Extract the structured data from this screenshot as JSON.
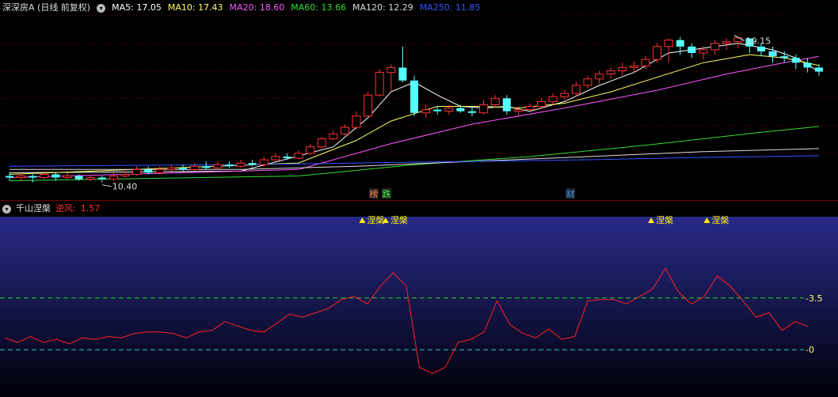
{
  "header": {
    "title": "深深房A (日线 前复权)",
    "ma_items": [
      {
        "label": "MA5:",
        "value": "17.05",
        "color": "#ffffff"
      },
      {
        "label": "MA10:",
        "value": "17.43",
        "color": "#ffff66"
      },
      {
        "label": "MA20:",
        "value": "18.60",
        "color": "#ff55ff"
      },
      {
        "label": "MA60:",
        "value": "13.66",
        "color": "#33dd33"
      },
      {
        "label": "MA120:",
        "value": "12.29",
        "color": "#dddddd"
      },
      {
        "label": "MA250:",
        "value": "11.85",
        "color": "#3355ff"
      }
    ]
  },
  "indicator": {
    "name": "千山涅槃",
    "wind_label": "逆风:",
    "wind_value": "1.57"
  },
  "colors": {
    "up": "#ff3333",
    "down": "#54ffff",
    "grid": "#7a0000",
    "ind_line": "#ff2222",
    "bg_top": "#272a88",
    "bg_bottom": "#000008"
  },
  "chart_data": [
    {
      "type": "candlestick",
      "name": "price",
      "ylim": [
        9.5,
        20.5
      ],
      "high_label": "19.15",
      "low_label": "10.40",
      "candles": [
        [
          10.6,
          10.5,
          10.8,
          10.3
        ],
        [
          10.5,
          10.6,
          10.8,
          10.3
        ],
        [
          10.6,
          10.5,
          10.7,
          10.2
        ],
        [
          10.5,
          10.7,
          10.9,
          10.4
        ],
        [
          10.7,
          10.5,
          10.8,
          10.3
        ],
        [
          10.5,
          10.6,
          10.8,
          10.4
        ],
        [
          10.6,
          10.4,
          10.7,
          10.3
        ],
        [
          10.4,
          10.5,
          10.6,
          10.3
        ],
        [
          10.5,
          10.4,
          10.6,
          10.2
        ],
        [
          10.4,
          10.6,
          10.8,
          10.3
        ],
        [
          10.6,
          10.7,
          10.9,
          10.5
        ],
        [
          10.7,
          11.0,
          11.2,
          10.6
        ],
        [
          11.0,
          10.8,
          11.2,
          10.7
        ],
        [
          10.8,
          11.0,
          11.2,
          10.7
        ],
        [
          11.0,
          11.1,
          11.3,
          10.9
        ],
        [
          11.1,
          11.0,
          11.3,
          10.9
        ],
        [
          11.0,
          11.2,
          11.4,
          10.9
        ],
        [
          11.2,
          11.1,
          11.5,
          11.0
        ],
        [
          11.1,
          11.3,
          11.5,
          11.0
        ],
        [
          11.3,
          11.2,
          11.5,
          11.1
        ],
        [
          11.2,
          11.4,
          11.6,
          11.1
        ],
        [
          11.4,
          11.3,
          11.6,
          11.2
        ],
        [
          11.3,
          11.6,
          11.8,
          11.2
        ],
        [
          11.6,
          11.8,
          12.0,
          11.5
        ],
        [
          11.8,
          11.7,
          12.0,
          11.6
        ],
        [
          11.7,
          12.0,
          12.2,
          11.6
        ],
        [
          12.0,
          12.4,
          12.6,
          11.9
        ],
        [
          12.4,
          12.9,
          13.0,
          12.3
        ],
        [
          12.9,
          13.2,
          13.4,
          12.8
        ],
        [
          13.2,
          13.6,
          13.8,
          13.1
        ],
        [
          13.6,
          14.3,
          14.6,
          13.5
        ],
        [
          14.3,
          15.6,
          15.8,
          14.2
        ],
        [
          15.6,
          17.0,
          17.2,
          15.5
        ],
        [
          17.0,
          17.3,
          17.5,
          15.8
        ],
        [
          17.3,
          16.5,
          18.6,
          16.4
        ],
        [
          16.5,
          14.5,
          16.8,
          14.3
        ],
        [
          14.5,
          14.7,
          15.0,
          14.2
        ],
        [
          14.7,
          14.6,
          14.9,
          14.4
        ],
        [
          14.6,
          14.8,
          15.0,
          14.4
        ],
        [
          14.8,
          14.6,
          15.0,
          14.5
        ],
        [
          14.6,
          14.5,
          14.9,
          14.3
        ],
        [
          14.5,
          15.0,
          15.3,
          14.4
        ],
        [
          15.0,
          15.4,
          15.6,
          14.8
        ],
        [
          15.4,
          14.6,
          15.6,
          14.4
        ],
        [
          14.6,
          14.7,
          14.9,
          14.3
        ],
        [
          14.7,
          14.9,
          15.1,
          14.6
        ],
        [
          14.9,
          15.2,
          15.4,
          14.8
        ],
        [
          15.2,
          15.5,
          15.7,
          15.0
        ],
        [
          15.5,
          15.7,
          15.9,
          15.3
        ],
        [
          15.7,
          16.2,
          16.4,
          15.5
        ],
        [
          16.2,
          16.6,
          16.8,
          16.0
        ],
        [
          16.6,
          16.9,
          17.1,
          16.3
        ],
        [
          16.9,
          17.1,
          17.3,
          16.6
        ],
        [
          17.1,
          17.3,
          17.6,
          16.8
        ],
        [
          17.3,
          17.4,
          17.7,
          17.0
        ],
        [
          17.4,
          17.8,
          18.0,
          17.2
        ],
        [
          17.8,
          18.6,
          18.8,
          17.6
        ],
        [
          18.6,
          19.0,
          19.1,
          17.6
        ],
        [
          19.0,
          18.6,
          19.2,
          18.1
        ],
        [
          18.6,
          18.2,
          18.8,
          17.9
        ],
        [
          18.2,
          18.4,
          18.6,
          17.8
        ],
        [
          18.4,
          18.8,
          19.0,
          18.1
        ],
        [
          18.8,
          18.9,
          19.1,
          18.4
        ],
        [
          18.9,
          19.15,
          19.15,
          18.5
        ],
        [
          19.1,
          18.6,
          19.1,
          18.2
        ],
        [
          18.6,
          18.3,
          18.8,
          18.0
        ],
        [
          18.3,
          18.0,
          18.6,
          17.6
        ],
        [
          18.0,
          17.9,
          18.3,
          17.6
        ],
        [
          17.9,
          17.6,
          18.1,
          17.2
        ],
        [
          17.6,
          17.3,
          17.9,
          17.0
        ],
        [
          17.3,
          17.05,
          17.5,
          16.8
        ]
      ],
      "ma_series": [
        {
          "name": "MA5",
          "color": "#ffffff",
          "points": [
            [
              0,
              10.8
            ],
            [
              20,
              10.9
            ],
            [
              28,
              12.4
            ],
            [
              31,
              14.2
            ],
            [
              33,
              15.8
            ],
            [
              35,
              16.4
            ],
            [
              37,
              15.6
            ],
            [
              39,
              14.9
            ],
            [
              41,
              14.8
            ],
            [
              43,
              14.9
            ],
            [
              45,
              14.6
            ],
            [
              48,
              15.2
            ],
            [
              51,
              16.2
            ],
            [
              54,
              17.0
            ],
            [
              57,
              18.2
            ],
            [
              60,
              18.5
            ],
            [
              63,
              18.8
            ],
            [
              66,
              18.4
            ],
            [
              68,
              17.9
            ],
            [
              70,
              17.05
            ]
          ]
        },
        {
          "name": "MA10",
          "color": "#ffff66",
          "points": [
            [
              0,
              10.7
            ],
            [
              25,
              11.4
            ],
            [
              30,
              12.8
            ],
            [
              33,
              14.0
            ],
            [
              37,
              14.9
            ],
            [
              41,
              14.9
            ],
            [
              44,
              14.8
            ],
            [
              48,
              15.1
            ],
            [
              52,
              15.8
            ],
            [
              56,
              16.7
            ],
            [
              60,
              17.6
            ],
            [
              64,
              18.1
            ],
            [
              67,
              17.9
            ],
            [
              70,
              17.43
            ]
          ]
        },
        {
          "name": "MA20",
          "color": "#ff55ff",
          "points": [
            [
              0,
              10.5
            ],
            [
              25,
              11.0
            ],
            [
              33,
              12.6
            ],
            [
              40,
              13.8
            ],
            [
              48,
              14.8
            ],
            [
              56,
              15.9
            ],
            [
              62,
              16.9
            ],
            [
              67,
              17.6
            ],
            [
              70,
              18.0
            ]
          ]
        },
        {
          "name": "MA60",
          "color": "#33dd33",
          "points": [
            [
              0,
              10.3
            ],
            [
              25,
              10.6
            ],
            [
              35,
              11.3
            ],
            [
              45,
              11.8
            ],
            [
              55,
              12.5
            ],
            [
              65,
              13.3
            ],
            [
              70,
              13.66
            ]
          ]
        },
        {
          "name": "MA120",
          "color": "#dddddd",
          "points": [
            [
              0,
              11.0
            ],
            [
              20,
              11.0
            ],
            [
              30,
              11.2
            ],
            [
              40,
              11.5
            ],
            [
              50,
              11.8
            ],
            [
              60,
              12.1
            ],
            [
              70,
              12.29
            ]
          ]
        },
        {
          "name": "MA250",
          "color": "#3355ff",
          "points": [
            [
              0,
              11.2
            ],
            [
              20,
              11.3
            ],
            [
              30,
              11.4
            ],
            [
              40,
              11.5
            ],
            [
              50,
              11.6
            ],
            [
              60,
              11.75
            ],
            [
              70,
              11.85
            ]
          ]
        }
      ],
      "markers": [
        {
          "index": 31.5,
          "text": "榜",
          "color": "#ff8844"
        },
        {
          "index": 32.6,
          "text": "跌",
          "color": "#44ff44"
        },
        {
          "index": 48.5,
          "text": "财",
          "color": "#4499ff"
        }
      ]
    },
    {
      "type": "line",
      "name": "逆风",
      "ylim": [
        -3.2,
        9.0
      ],
      "ref_lines": [
        {
          "value": 3.5,
          "label": "3.5",
          "color": "#22dd22"
        },
        {
          "value": 0,
          "label": "0",
          "color": "#22cccc"
        }
      ],
      "values": [
        0.8,
        0.5,
        0.9,
        0.5,
        0.7,
        0.4,
        0.8,
        0.7,
        0.9,
        0.8,
        1.1,
        1.2,
        1.2,
        1.1,
        0.8,
        1.2,
        1.3,
        1.9,
        1.6,
        1.3,
        1.2,
        1.8,
        2.4,
        2.2,
        2.5,
        2.8,
        3.4,
        3.6,
        3.1,
        4.3,
        5.2,
        4.3,
        -1.2,
        -1.6,
        -1.2,
        0.5,
        0.7,
        1.2,
        3.3,
        1.7,
        1.1,
        0.8,
        1.4,
        0.7,
        0.9,
        3.3,
        3.4,
        3.4,
        3.1,
        3.6,
        4.1,
        5.5,
        3.9,
        3.1,
        3.6,
        5.0,
        4.3,
        3.3,
        2.2,
        2.5,
        1.3,
        1.9,
        1.57
      ],
      "signal_text": "涅槃",
      "signals": [
        27.6,
        29.4,
        49.9,
        54.2
      ]
    }
  ]
}
